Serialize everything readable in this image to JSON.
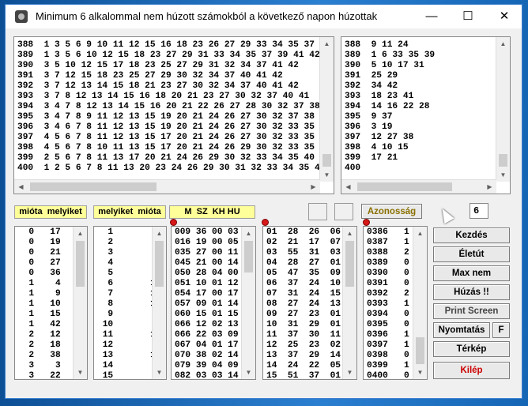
{
  "window": {
    "title": "Minimum 6 alkalommal nem húzott számokból a következő napon húzottak"
  },
  "titlebar_buttons": {
    "minimize": "—",
    "maximize": "☐",
    "close": "✕"
  },
  "top_left_lines": [
    "388  1 3 5 6 9 10 11 12 15 16 18 23 26 27 29 33 34 35 37 39 41 42",
    "389  1 3 5 6 10 12 15 18 23 27 29 31 33 34 35 37 39 41 42",
    "390  3 5 10 12 15 17 18 23 25 27 29 31 32 34 37 41 42",
    "391  3 7 12 15 18 23 25 27 29 30 32 34 37 40 41 42",
    "392  3 7 12 13 14 15 18 21 23 27 30 32 34 37 40 41 42",
    "393  3 7 8 12 13 14 15 16 18 20 21 23 27 30 32 37 40 41",
    "394  3 4 7 8 12 13 14 15 16 20 21 22 26 27 28 30 32 37 38 40",
    "395  3 4 7 8 9 11 12 13 15 19 20 21 24 26 27 30 32 37 38 40",
    "396  3 4 6 7 8 11 12 13 15 19 20 21 24 26 27 30 32 33 35 38 40",
    "397  4 5 6 7 8 11 12 13 15 17 20 21 24 26 27 30 32 33 35 38 40",
    "398  4 5 6 7 8 10 11 13 15 17 20 21 24 26 29 30 32 33 35 40",
    "399  2 5 6 7 8 11 13 17 20 21 24 26 29 30 32 33 34 35 40",
    "400  1 2 5 6 7 8 11 13 20 23 24 26 29 30 31 32 33 34 35 40 41"
  ],
  "top_right_lines": [
    "388  9 11 24",
    "389  1 6 33 35 39",
    "390  5 10 17 31",
    "391  25 29",
    "392  34 42",
    "393  18 23 41",
    "394  14 16 22 28",
    "395  9 37",
    "396  3 19",
    "397  12 27 38",
    "398  4 10 15",
    "399  17 21",
    "400"
  ],
  "headers": {
    "mióta_melyiket": "mióta  melyiket",
    "melyiket_mióta": "melyiket  mióta",
    "m_sz_kh_hu": "M  SZ  KH HU"
  },
  "list1_lines": [
    "  0   17    9",
    "  0   19    3",
    "  0   21   14",
    "  0   27    2",
    "  0   36    3",
    "  1    4   11",
    "  1    9    1",
    "  1   10    7",
    "  1   15   18",
    "  1   42    6",
    "  2   12   18",
    "  2   18    4",
    "  2   38   10",
    "  3    3   17",
    "  3   22    2"
  ],
  "list2_lines": [
    "  1        6",
    "  2        7",
    "  3        3",
    "  4        1",
    "  5        9",
    "  6       10",
    "  7       15",
    "  8       13",
    "  9        1",
    " 10        1",
    " 11       11",
    " 12        2",
    " 13       14",
    " 14        5",
    " 15        1"
  ],
  "list3_lines": [
    "009 36 00 03",
    "016 19 00 05",
    "035 27 00 11",
    "045 21 00 14",
    "050 28 04 00",
    "051 10 01 12",
    "054 17 00 17",
    "057 09 01 14",
    "060 15 01 15",
    "066 12 02 13",
    "066 22 03 09",
    "067 04 01 17",
    "070 38 02 14",
    "079 39 04 09",
    "082 03 03 14"
  ],
  "list4_lines": [
    "01  28  26  06",
    "02  21  17  07",
    "03  55  31  03",
    "04  28  27  01",
    "05  47  35  09",
    "06  37  24  10",
    "07  31  24  15",
    "08  27  24  13",
    "09  27  23  01",
    "10  31  29  01",
    "11  37  30  11",
    "12  25  23  02",
    "13  37  29  14",
    "14  24  22  05",
    "15  51  37  01"
  ],
  "list5_lines": [
    "0386   1",
    "0387   1",
    "0388   2",
    "0389   0",
    "0390   0",
    "0391   0",
    "0392   2",
    "0393   1",
    "0394   0",
    "0395   0",
    "0396   1",
    "0397   1",
    "0398   0",
    "0399   1",
    "0400   0"
  ],
  "controls": {
    "azonossag": "Azonosság",
    "number_value": "6"
  },
  "buttons": {
    "kezdes": "Kezdés",
    "eletut": "Életút",
    "max_nem": "Max nem",
    "huzas": "Húzás !!",
    "print_screen": "Print Screen",
    "nyomtatas": "Nyomtatás",
    "f": "F",
    "terkep": "Térkép",
    "kilep": "Kilép"
  },
  "colors": {
    "header_bg": "#ffff99",
    "dot": "#d61818",
    "exit_text": "#cc0000"
  }
}
